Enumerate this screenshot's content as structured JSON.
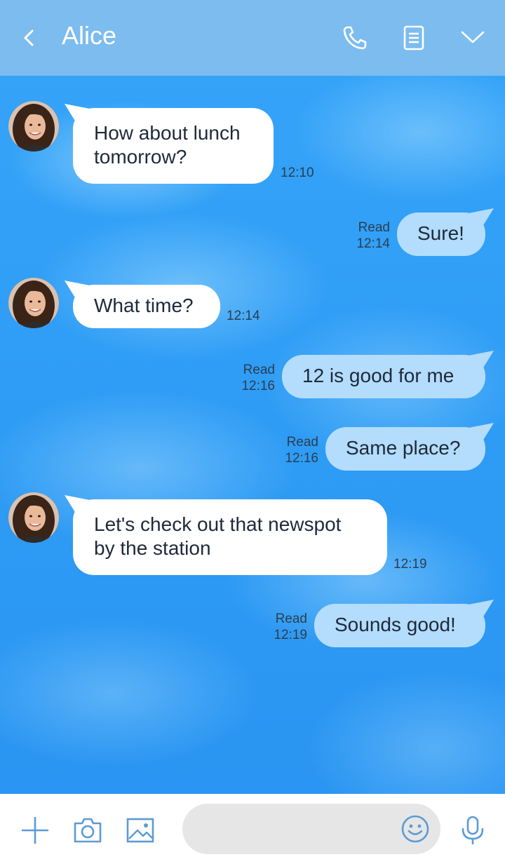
{
  "header": {
    "title": "Alice"
  },
  "messages": [
    {
      "side": "in",
      "text_lines": [
        "How about lunch",
        "tomorrow?"
      ],
      "time": "12:10"
    },
    {
      "side": "out",
      "text": "Sure!",
      "status": "Read",
      "time": "12:14"
    },
    {
      "side": "in",
      "text_lines": [
        "What time?"
      ],
      "time": "12:14"
    },
    {
      "side": "out",
      "text": "12 is good for me",
      "status": "Read",
      "time": "12:16"
    },
    {
      "side": "out",
      "text": "Same place?",
      "status": "Read",
      "time": "12:16"
    },
    {
      "side": "in",
      "text_lines": [
        "Let's check out that newspot",
        "by the station"
      ],
      "time": "12:19"
    },
    {
      "side": "out",
      "text": "Sounds good!",
      "status": "Read",
      "time": "12:19"
    }
  ],
  "composer": {
    "placeholder": ""
  },
  "icons": {
    "back": "chevron-left-icon",
    "call": "phone-icon",
    "notes": "document-icon",
    "menu": "chevron-down-icon",
    "add": "plus-icon",
    "camera": "camera-icon",
    "gallery": "image-icon",
    "emoji": "smiley-icon",
    "voice": "microphone-icon"
  },
  "colors": {
    "header_bg": "#7dbcef",
    "chat_bg": "#2e9cf5",
    "incoming_bubble": "#ffffff",
    "outgoing_bubble": "#b4dcfc",
    "icon_accent": "#5b9bd5"
  }
}
